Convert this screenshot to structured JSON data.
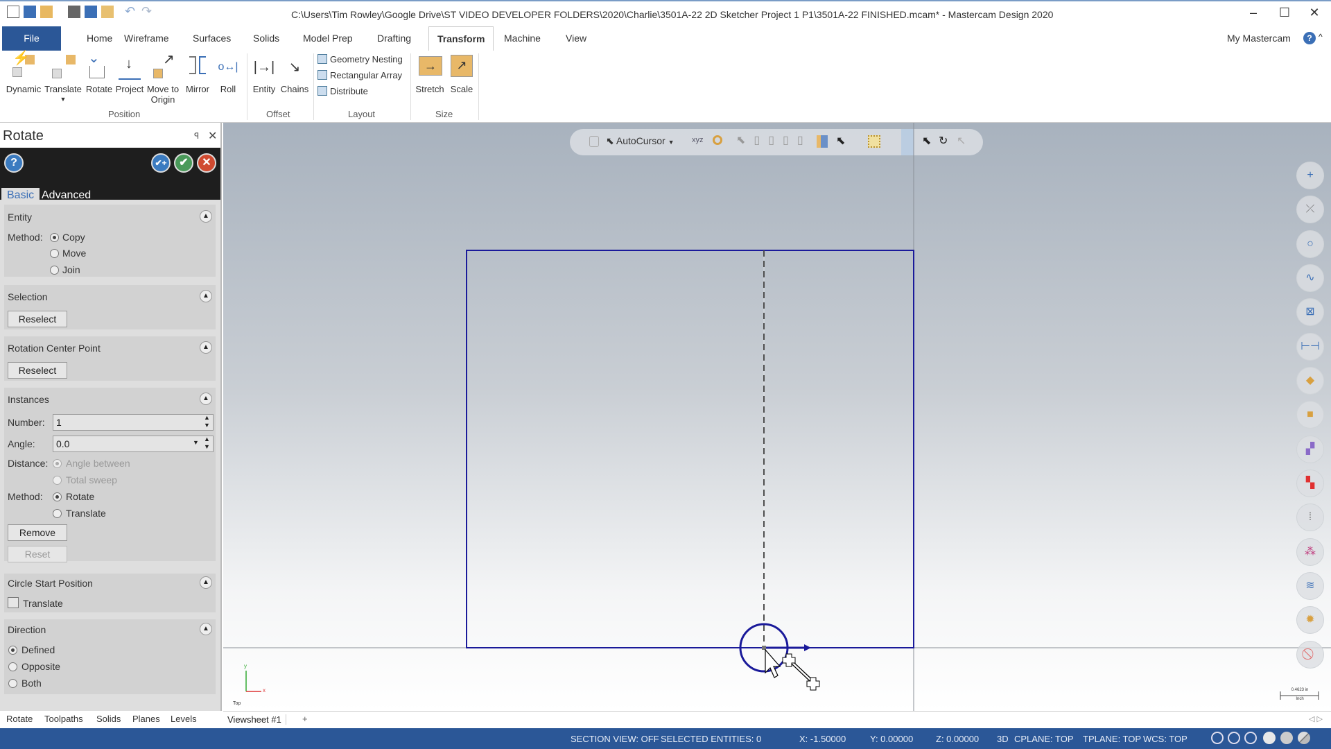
{
  "window": {
    "title": "C:\\Users\\Tim Rowley\\Google Drive\\ST VIDEO DEVELOPER FOLDERS\\2020\\Charlie\\3501A-22 2D Sketcher Project 1 P1\\3501A-22 FINISHED.mcam* - Mastercam Design 2020",
    "minimize": "‒",
    "maximize": "☐",
    "close": "✕"
  },
  "tabs": {
    "file": "File",
    "items": [
      "Home",
      "Wireframe",
      "Surfaces",
      "Solids",
      "Model Prep",
      "Drafting",
      "Transform",
      "Machine",
      "View"
    ],
    "active": "Transform",
    "my_mastercam": "My Mastercam"
  },
  "ribbon": {
    "position": {
      "label": "Position",
      "buttons": [
        "Dynamic",
        "Translate",
        "Rotate",
        "Project",
        "Move to Origin",
        "Mirror",
        "Roll"
      ]
    },
    "offset": {
      "label": "Offset",
      "buttons": [
        "Entity",
        "Chains"
      ]
    },
    "layout": {
      "label": "Layout",
      "buttons": [
        "Geometry Nesting",
        "Rectangular Array",
        "Distribute"
      ]
    },
    "size": {
      "label": "Size",
      "buttons": [
        "Stretch",
        "Scale"
      ]
    }
  },
  "panel": {
    "title": "Rotate",
    "pin": "⌖",
    "close": "✕",
    "tabs": [
      "Basic",
      "Advanced"
    ],
    "entity": {
      "header": "Entity",
      "method_label": "Method:",
      "options": [
        "Copy",
        "Move",
        "Join"
      ],
      "selected": "Copy"
    },
    "selection": {
      "header": "Selection",
      "button": "Reselect"
    },
    "center": {
      "header": "Rotation Center Point",
      "button": "Reselect"
    },
    "instances": {
      "header": "Instances",
      "number_label": "Number:",
      "number": "1",
      "angle_label": "Angle:",
      "angle": "0.0",
      "distance_label": "Distance:",
      "distance_options": [
        "Angle between",
        "Total sweep"
      ],
      "distance_selected": "Angle between",
      "method_label": "Method:",
      "method_options": [
        "Rotate",
        "Translate"
      ],
      "method_selected": "Rotate",
      "remove": "Remove",
      "reset": "Reset"
    },
    "circle_start": {
      "header": "Circle Start Position",
      "checkbox": "Translate",
      "checked": false
    },
    "direction": {
      "header": "Direction",
      "options": [
        "Defined",
        "Opposite",
        "Both"
      ],
      "selected": "Defined"
    }
  },
  "bottom_tabs": [
    "Rotate",
    "Toolpaths",
    "Solids",
    "Planes",
    "Levels"
  ],
  "viewsheet": {
    "tab": "Viewsheet #1",
    "add": "+"
  },
  "viewport": {
    "autocursor": "AutoCursor",
    "view_label": "Top",
    "axis_x": "x",
    "axis_y": "y",
    "scale_value": "0.4623 in",
    "scale_unit": "Inch",
    "geometry_color": "#1a1a9a"
  },
  "status": {
    "section_view": "SECTION VIEW: OFF",
    "selected": "SELECTED ENTITIES: 0",
    "x": "X:  -1.50000",
    "y": "Y:  0.00000",
    "z": "Z:  0.00000",
    "mode": "3D",
    "cplane": "CPLANE: TOP",
    "tplane": "TPLANE: TOP",
    "wcs": "WCS: TOP"
  },
  "colors": {
    "accent": "#2b5797",
    "panel_bar": "#1e1e1e"
  }
}
